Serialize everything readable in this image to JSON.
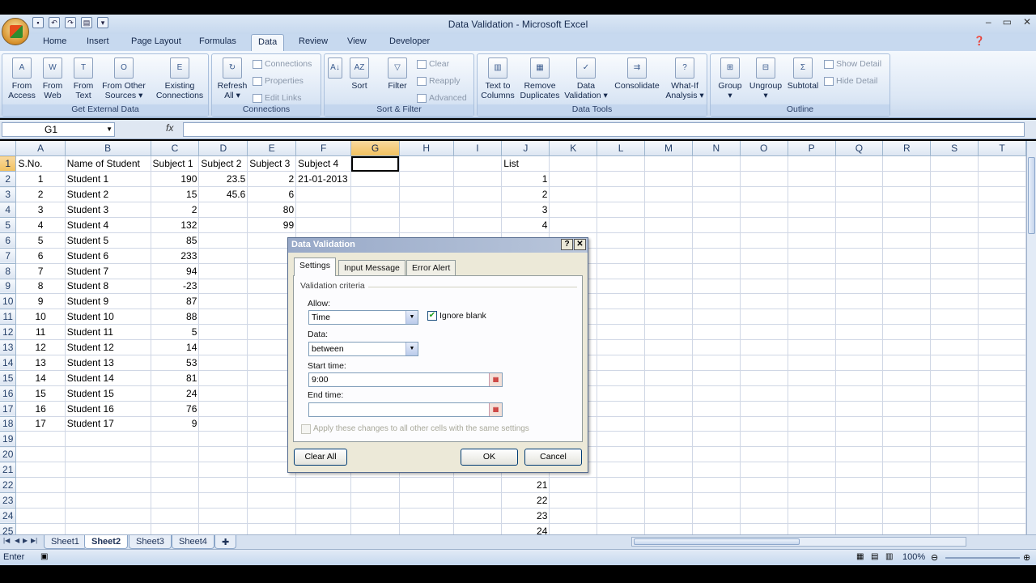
{
  "window": {
    "title": "Data Validation - Microsoft Excel"
  },
  "qat_icons": [
    "save-icon",
    "undo-icon",
    "redo-icon",
    "print-preview-icon",
    "customize-icon"
  ],
  "ribbon_tabs": [
    "Home",
    "Insert",
    "Page Layout",
    "Formulas",
    "Data",
    "Review",
    "View",
    "Developer"
  ],
  "active_tab": "Data",
  "ribbon": {
    "get_external": {
      "label": "Get External Data",
      "buttons": [
        [
          "From",
          "Access"
        ],
        [
          "From",
          "Web"
        ],
        [
          "From",
          "Text"
        ],
        [
          "From Other",
          "Sources ▾"
        ],
        [
          "Existing",
          "Connections"
        ]
      ]
    },
    "connections": {
      "label": "Connections",
      "refresh": [
        "Refresh",
        "All ▾"
      ],
      "small": [
        "Connections",
        "Properties",
        "Edit Links"
      ]
    },
    "sortfilter": {
      "label": "Sort & Filter",
      "sort": "Sort",
      "filter": "Filter",
      "small": [
        "Clear",
        "Reapply",
        "Advanced"
      ]
    },
    "datatools": {
      "label": "Data Tools",
      "buttons": [
        [
          "Text to",
          "Columns"
        ],
        [
          "Remove",
          "Duplicates"
        ],
        [
          "Data",
          "Validation ▾"
        ],
        [
          "Consolidate",
          ""
        ],
        [
          "What-If",
          "Analysis ▾"
        ]
      ]
    },
    "outline": {
      "label": "Outline",
      "buttons": [
        [
          "Group",
          "▾"
        ],
        [
          "Ungroup",
          "▾"
        ],
        [
          "Subtotal",
          ""
        ]
      ],
      "small": [
        "Show Detail",
        "Hide Detail"
      ]
    }
  },
  "formula_bar": {
    "name_box": "G1",
    "fx": "fx",
    "value": ""
  },
  "sheet": {
    "columns": [
      "A",
      "B",
      "C",
      "D",
      "E",
      "F",
      "G",
      "H",
      "I",
      "J",
      "K",
      "L",
      "M",
      "N",
      "O",
      "P",
      "Q",
      "R",
      "S",
      "T"
    ],
    "selected_col": "G",
    "header_row": [
      "S.No.",
      "Name of Student",
      "Subject 1",
      "Subject 2",
      "Subject 3",
      "Subject 4",
      "",
      "",
      "",
      "List"
    ],
    "rows": [
      [
        "1",
        "Student 1",
        "190",
        "23.5",
        "2",
        "21-01-2013",
        "",
        "",
        "",
        "1"
      ],
      [
        "2",
        "Student 2",
        "15",
        "45.6",
        "6",
        "",
        "",
        "",
        "",
        "2"
      ],
      [
        "3",
        "Student 3",
        "2",
        "",
        "80",
        "",
        "",
        "",
        "",
        "3"
      ],
      [
        "4",
        "Student 4",
        "132",
        "",
        "99",
        "",
        "",
        "",
        "",
        "4"
      ],
      [
        "5",
        "Student 5",
        "85",
        "",
        "",
        "",
        "",
        "",
        "",
        ""
      ],
      [
        "6",
        "Student 6",
        "233",
        "",
        "",
        "",
        "",
        "",
        "",
        ""
      ],
      [
        "7",
        "Student 7",
        "94",
        "",
        "",
        "",
        "",
        "",
        "",
        ""
      ],
      [
        "8",
        "Student 8",
        "-23",
        "",
        "",
        "",
        "",
        "",
        "",
        ""
      ],
      [
        "9",
        "Student 9",
        "87",
        "",
        "",
        "",
        "",
        "",
        "",
        ""
      ],
      [
        "10",
        "Student 10",
        "88",
        "",
        "",
        "",
        "",
        "",
        "",
        ""
      ],
      [
        "11",
        "Student 11",
        "5",
        "",
        "",
        "",
        "",
        "",
        "",
        ""
      ],
      [
        "12",
        "Student 12",
        "14",
        "",
        "",
        "",
        "",
        "",
        "",
        ""
      ],
      [
        "13",
        "Student 13",
        "53",
        "",
        "",
        "",
        "",
        "",
        "",
        ""
      ],
      [
        "14",
        "Student 14",
        "81",
        "",
        "",
        "",
        "",
        "",
        "",
        ""
      ],
      [
        "15",
        "Student 15",
        "24",
        "",
        "",
        "",
        "",
        "",
        "",
        ""
      ],
      [
        "16",
        "Student 16",
        "76",
        "",
        "",
        "",
        "",
        "",
        "",
        ""
      ],
      [
        "17",
        "Student 17",
        "9",
        "",
        "",
        "",
        "",
        "",
        "",
        ""
      ],
      [
        "",
        "",
        "",
        "",
        "",
        "",
        "",
        "",
        "",
        ""
      ],
      [
        "",
        "",
        "",
        "",
        "",
        "",
        "",
        "",
        "",
        ""
      ],
      [
        "",
        "",
        "",
        "",
        "",
        "",
        "",
        "",
        "",
        ""
      ],
      [
        "",
        "",
        "",
        "",
        "",
        "",
        "",
        "",
        "",
        "21"
      ],
      [
        "",
        "",
        "",
        "",
        "",
        "",
        "",
        "",
        "",
        "22"
      ],
      [
        "",
        "",
        "",
        "",
        "",
        "",
        "",
        "",
        "",
        "23"
      ],
      [
        "",
        "",
        "",
        "",
        "",
        "",
        "",
        "",
        "",
        "24"
      ]
    ]
  },
  "sheet_tabs": [
    "Sheet1",
    "Sheet2",
    "Sheet3",
    "Sheet4"
  ],
  "active_sheet": "Sheet2",
  "status": {
    "mode": "Enter",
    "zoom": "100%"
  },
  "dialog": {
    "title": "Data Validation",
    "tabs": [
      "Settings",
      "Input Message",
      "Error Alert"
    ],
    "active_tab": "Settings",
    "group_label": "Validation criteria",
    "allow_label": "Allow:",
    "allow_value": "Time",
    "ignore_blank": "Ignore blank",
    "data_label": "Data:",
    "data_value": "between",
    "start_label": "Start time:",
    "start_value": "9:00",
    "end_label": "End time:",
    "end_value": "",
    "apply_all": "Apply these changes to all other cells with the same settings",
    "clear_all": "Clear All",
    "ok": "OK",
    "cancel": "Cancel"
  }
}
